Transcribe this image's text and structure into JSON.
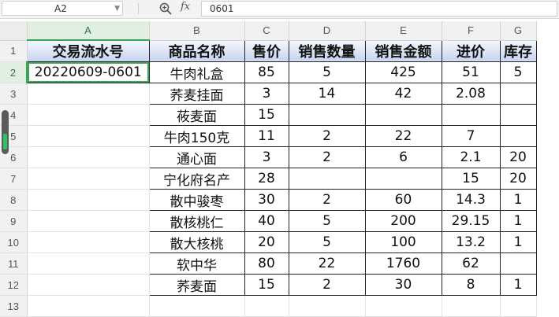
{
  "formula_bar": {
    "cell_ref": "A2",
    "fx_label": "fx",
    "formula": "0601"
  },
  "columns": [
    "A",
    "B",
    "C",
    "D",
    "E",
    "F",
    "G"
  ],
  "rows": [
    {
      "num": "1",
      "cells": [
        "交易流水号",
        "商品名称",
        "售价",
        "销售数量",
        "销售金额",
        "进价",
        "库存"
      ]
    },
    {
      "num": "2",
      "cells": [
        "20220609-0601",
        "牛肉礼盒",
        "85",
        "5",
        "425",
        "51",
        "5"
      ]
    },
    {
      "num": "3",
      "cells": [
        "",
        "荞麦挂面",
        "3",
        "14",
        "42",
        "2.08",
        ""
      ]
    },
    {
      "num": "4",
      "cells": [
        "",
        "莜麦面",
        "15",
        "",
        "",
        "",
        ""
      ]
    },
    {
      "num": "5",
      "cells": [
        "",
        "牛肉150克",
        "11",
        "2",
        "22",
        "7",
        ""
      ]
    },
    {
      "num": "6",
      "cells": [
        "",
        "通心面",
        "3",
        "2",
        "6",
        "2.1",
        "20"
      ]
    },
    {
      "num": "7",
      "cells": [
        "",
        "宁化府名产",
        "28",
        "",
        "",
        "15",
        "20"
      ]
    },
    {
      "num": "8",
      "cells": [
        "",
        "散中骏枣",
        "30",
        "2",
        "60",
        "14.3",
        "1"
      ]
    },
    {
      "num": "9",
      "cells": [
        "",
        "散核桃仁",
        "40",
        "5",
        "200",
        "29.15",
        "1"
      ]
    },
    {
      "num": "10",
      "cells": [
        "",
        "散大核桃",
        "20",
        "5",
        "100",
        "13.2",
        "1"
      ]
    },
    {
      "num": "11",
      "cells": [
        "",
        "软中华",
        "80",
        "22",
        "1760",
        "62",
        ""
      ]
    },
    {
      "num": "12",
      "cells": [
        "",
        "荞麦面",
        "15",
        "2",
        "30",
        "8",
        "1"
      ]
    },
    {
      "num": "13",
      "cells": [
        "",
        "",
        "",
        "",
        "",
        "",
        ""
      ]
    }
  ],
  "colors": {
    "selection": "#3aa655",
    "header_fill_top": "#f4f7fd",
    "header_fill_bottom": "#c7d4ef"
  }
}
